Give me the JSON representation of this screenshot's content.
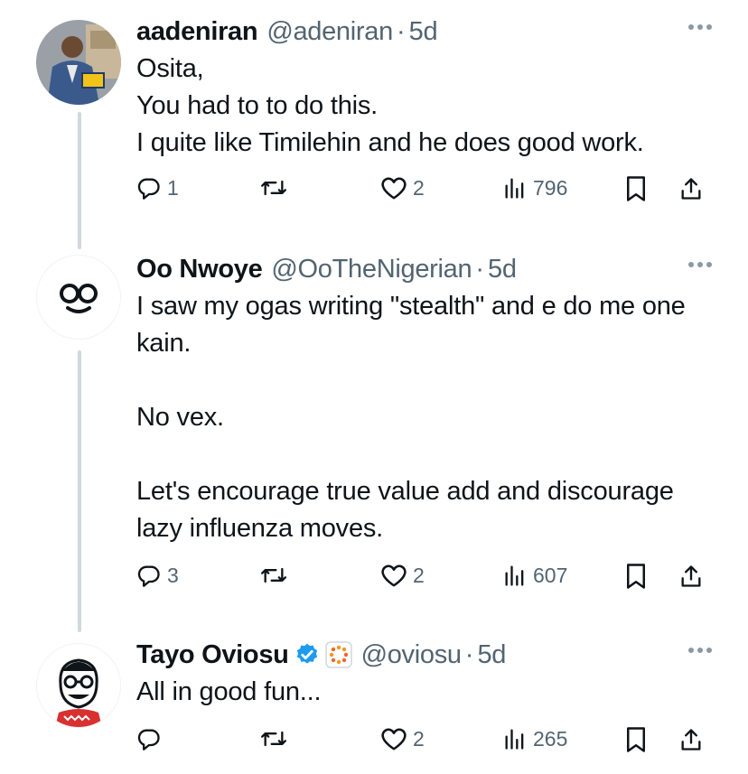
{
  "tweets": [
    {
      "display_name": "aadeniran",
      "handle": "@adeniran",
      "separator": "·",
      "time": "5d",
      "body": "Osita,\nYou had to to do this.\nI quite like Timilehin and he does good work.",
      "replies": "1",
      "reposts": "",
      "likes": "2",
      "views": "796"
    },
    {
      "display_name": "Oo Nwoye",
      "handle": "@OoTheNigerian",
      "separator": "·",
      "time": "5d",
      "body": "I saw my ogas writing \"stealth\" and e do me one kain.\n\nNo vex.\n\nLet's encourage true value add and discourage lazy influenza moves.",
      "replies": "3",
      "reposts": "",
      "likes": "2",
      "views": "607"
    },
    {
      "display_name": "Tayo Oviosu",
      "handle": "@oviosu",
      "separator": "·",
      "time": "5d",
      "body": "All in good fun...",
      "replies": "",
      "reposts": "",
      "likes": "2",
      "views": "265",
      "verified": true,
      "affiliate_badge": "paga-logo"
    }
  ],
  "icons": {
    "reply": "reply-icon",
    "repost": "repost-icon",
    "like": "like-icon",
    "views": "views-icon",
    "bookmark": "bookmark-icon",
    "share": "share-icon",
    "more": "more-icon"
  },
  "colors": {
    "text": "#0f1419",
    "secondary": "#536471",
    "thread_line": "#cfd9de",
    "verified": "#1d9bf0"
  }
}
